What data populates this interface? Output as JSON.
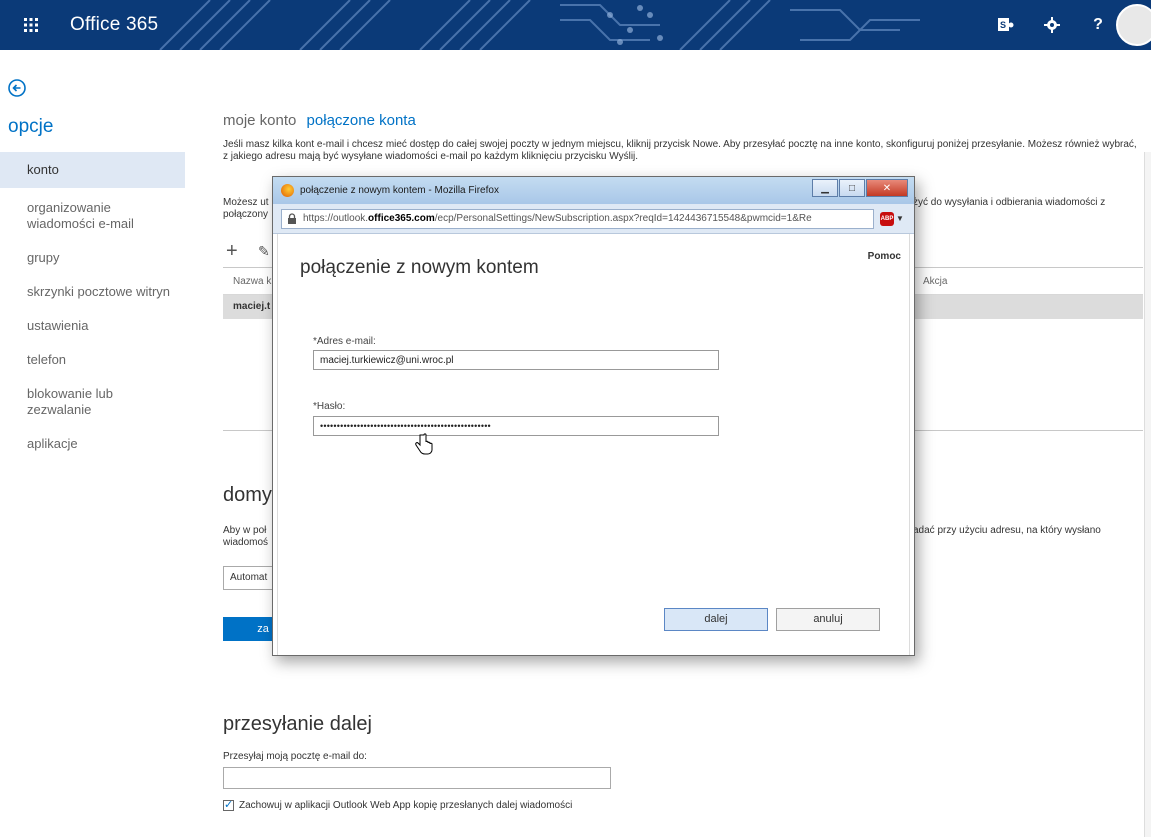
{
  "topbar": {
    "brand": "Office 365",
    "icons": [
      "waffle-icon",
      "skype-icon",
      "gear-icon",
      "help-icon"
    ],
    "help_label": "?"
  },
  "nav": {
    "heading": "opcje",
    "items": [
      {
        "label": "konto",
        "active": true
      },
      {
        "label": "organizowanie wiadomości e-mail"
      },
      {
        "label": "grupy"
      },
      {
        "label": "skrzynki pocztowe witryn"
      },
      {
        "label": "ustawienia"
      },
      {
        "label": "telefon"
      },
      {
        "label": "blokowanie lub zezwalanie"
      },
      {
        "label": "aplikacje"
      }
    ]
  },
  "main": {
    "tab_account": "moje konto",
    "tab_connected": "połączone konta",
    "para1": "Jeśli masz kilka kont e-mail i chcesz mieć dostęp do całej swojej poczty w jednym miejscu, kliknij przycisk Nowe. Aby przesyłać pocztę na inne konto, skonfiguruj poniżej przesyłanie. Możesz również wybrać, z jakiego adresu mają być wysyłane wiadomości e-mail po każdym kliknięciu przycisku Wyślij.",
    "para2_left": "Możesz ut",
    "para2_left2": "połączony",
    "para2_right": "żyć do wysyłania i odbierania wiadomości z",
    "grid_col_name": "Nazwa k",
    "grid_col_action": "Akcja",
    "grid_row": "maciej.t",
    "default_title": "domy",
    "default_text_left": "Aby w poł",
    "default_text_left2": "wiadomoś",
    "default_text_right": "adać przy użyciu adresu, na który wysłano",
    "dropdown": "Automat",
    "save_label": "za",
    "forward_title": "przesyłanie dalej",
    "forward_label": "Przesyłaj moją pocztę e-mail do:",
    "forward_value": "",
    "keep_copy_label": "Zachowuj w aplikacji Outlook Web App kopię przesłanych dalej wiadomości",
    "keep_copy_checked": true
  },
  "popup": {
    "window_title": "połączenie z nowym kontem - Mozilla Firefox",
    "url_prefix": "https://outlook.",
    "url_host": "office365.com",
    "url_suffix": "/ecp/PersonalSettings/NewSubscription.aspx?reqId=1424436715548&pwmcid=1&Re",
    "heading": "połączenie z nowym kontem",
    "help": "Pomoc",
    "email_label": "*Adres e-mail:",
    "email_value": "maciej.turkiewicz@uni.wroc.pl",
    "password_label": "*Hasło:",
    "password_value": "•••••••••••••••••••••••••••••••••••••••••••••••••••",
    "next_label": "dalej",
    "cancel_label": "anuluj",
    "win_minimize": "▁",
    "win_maximize": "□",
    "win_close": "✕",
    "abp_text": "ABP"
  }
}
